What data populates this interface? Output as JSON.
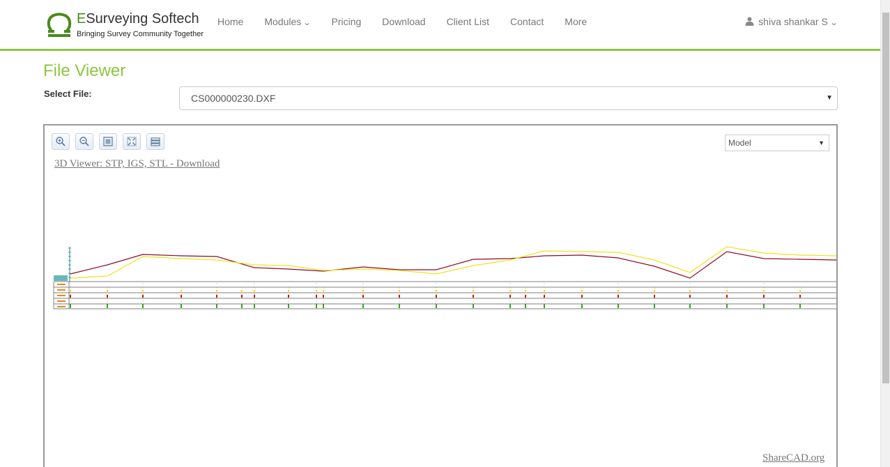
{
  "brand": {
    "name_initial": "E",
    "name_rest": "Surveying Softech",
    "tagline": "Bringing Survey Community Together",
    "color": "#4a8a1c"
  },
  "nav": {
    "items": [
      {
        "label": "Home"
      },
      {
        "label": "Modules",
        "dropdown": true
      },
      {
        "label": "Pricing"
      },
      {
        "label": "Download"
      },
      {
        "label": "Client List"
      },
      {
        "label": "Contact"
      },
      {
        "label": "More"
      }
    ],
    "user": {
      "name": "shiva shankar S",
      "icon": "user-icon"
    }
  },
  "page": {
    "title": "File Viewer",
    "select_label": "Select File:",
    "selected_file": "CS000000230.DXF",
    "accent_color": "#8dc63f"
  },
  "viewer": {
    "toolbar": [
      "zoom-in-icon",
      "zoom-out-icon",
      "fit-view-icon",
      "fullscreen-icon",
      "layers-icon"
    ],
    "layout_select": "Model",
    "link_text": "3D Viewer: STP, IGS, STL - Download",
    "footer_link": "ShareCAD.org",
    "line_colors": {
      "existing": "#8b0a2a",
      "proposed": "#f0e31a"
    }
  }
}
